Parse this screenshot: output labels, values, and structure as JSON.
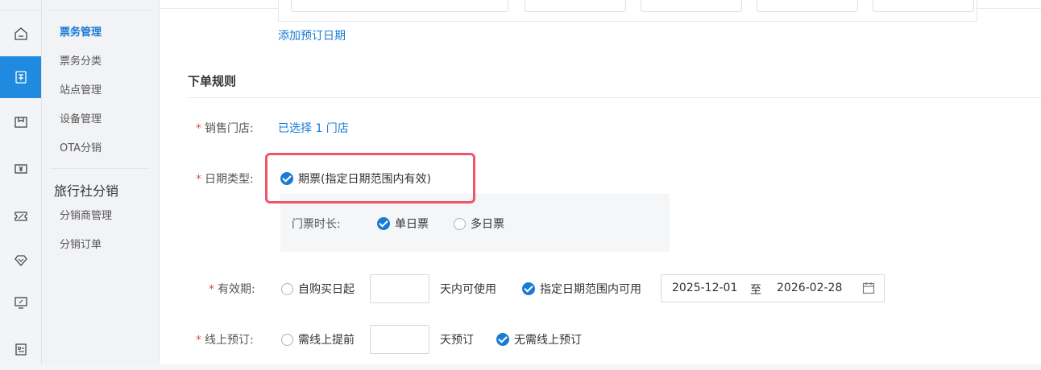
{
  "rail": {
    "icons": [
      "home-icon",
      "ticket-icon",
      "package-icon",
      "money-icon",
      "discount-icon",
      "diamond-icon",
      "monitor-icon",
      "contacts-icon"
    ],
    "active_index": 1
  },
  "submenu": {
    "items": [
      {
        "label": "票务管理",
        "active": true
      },
      {
        "label": "票务分类"
      },
      {
        "label": "站点管理"
      },
      {
        "label": "设备管理"
      },
      {
        "label": "OTA分销"
      }
    ],
    "group_title": "旅行社分销",
    "group_items": [
      {
        "label": "分销商管理"
      },
      {
        "label": "分销订单"
      }
    ]
  },
  "form": {
    "add_date_link": "添加预订日期",
    "section_title": "下单规则",
    "store": {
      "required": "*",
      "label": "销售门店:",
      "value": "已选择 1 门店"
    },
    "date_type": {
      "required": "*",
      "label": "日期类型:",
      "option": "期票(指定日期范围内有效)"
    },
    "duration": {
      "label": "门票时长:",
      "single": "单日票",
      "multi": "多日票",
      "selected": "单日票"
    },
    "validity": {
      "required": "*",
      "label": "有效期:",
      "option1": "自购买日起",
      "option1_suffix": "天内可使用",
      "option2": "指定日期范围内可用",
      "start_date": "2025-12-01",
      "to": "至",
      "end_date": "2026-02-28",
      "selected": "指定日期范围内可用"
    },
    "online": {
      "required": "*",
      "label": "线上预订:",
      "option1": "需线上提前",
      "option1_suffix": "天预订",
      "option2": "无需线上预订",
      "selected": "无需线上预订"
    }
  },
  "colors": {
    "accent": "#1a7bd4",
    "highlight": "#f0566a",
    "required": "#e0504a"
  }
}
